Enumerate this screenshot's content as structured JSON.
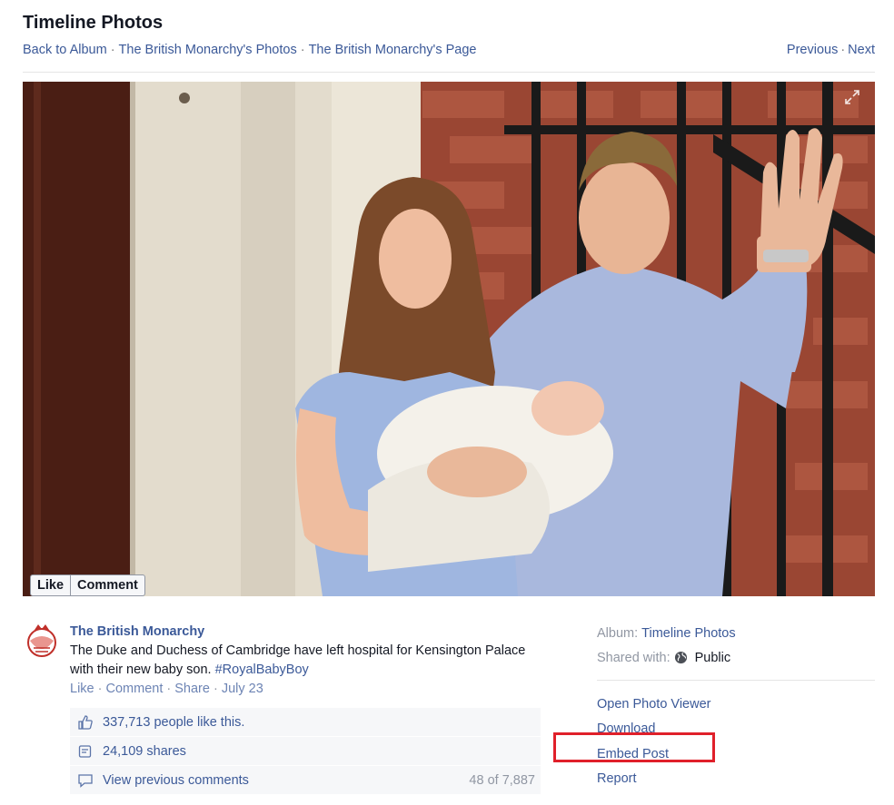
{
  "header": {
    "title": "Timeline Photos",
    "breadcrumb": [
      "Back to Album",
      "The British Monarchy's Photos",
      "The British Monarchy's Page"
    ],
    "pager": {
      "previous": "Previous",
      "next": "Next"
    }
  },
  "photo": {
    "like_label": "Like",
    "comment_label": "Comment"
  },
  "post": {
    "author": "The British Monarchy",
    "text": "The Duke and Duchess of Cambridge have left hospital for Kensington Palace with their new baby son. ",
    "hashtag": "#RoyalBabyBoy",
    "actions": {
      "like": "Like",
      "comment": "Comment",
      "share": "Share",
      "date": "July 23"
    },
    "ufi": {
      "likes": "337,713 people like this.",
      "shares": "24,109 shares",
      "previous_comments": "View previous comments",
      "comment_count": "48 of 7,887"
    }
  },
  "sidebar": {
    "album_label": "Album:",
    "album_value": "Timeline Photos",
    "shared_label": "Shared with:",
    "shared_value": "Public",
    "actions": [
      "Open Photo Viewer",
      "Download",
      "Embed Post",
      "Report"
    ]
  },
  "colors": {
    "link": "#3b5998",
    "highlight": "#e0202a",
    "ufi_bg": "#f6f7f9"
  }
}
